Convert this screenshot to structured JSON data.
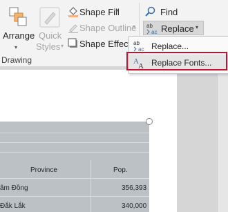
{
  "ribbon": {
    "arrange_label": "Arrange",
    "quick_styles_label": "Quick Styles",
    "quick_label": "Quick",
    "styles_label": "Styles",
    "shape_fill_label": "Shape Fill",
    "shape_outline_label": "Shape Outline",
    "shape_effects_label": "Shape Effects",
    "find_label": "Find",
    "replace_label": "Replace",
    "drawing_group_label": "Drawing"
  },
  "replace_menu": {
    "items": [
      {
        "label": "Replace...",
        "icon": "replace-icon"
      },
      {
        "label": "Replace Fonts...",
        "icon": "replace-fonts-icon"
      }
    ],
    "highlight_color": "#c8102e"
  },
  "table": {
    "headers": [
      "Province",
      "Pop."
    ],
    "rows": [
      {
        "province": "âm Đồng",
        "pop": "356,393"
      },
      {
        "province": "Đắk Lắk",
        "pop": "340,000"
      }
    ]
  }
}
